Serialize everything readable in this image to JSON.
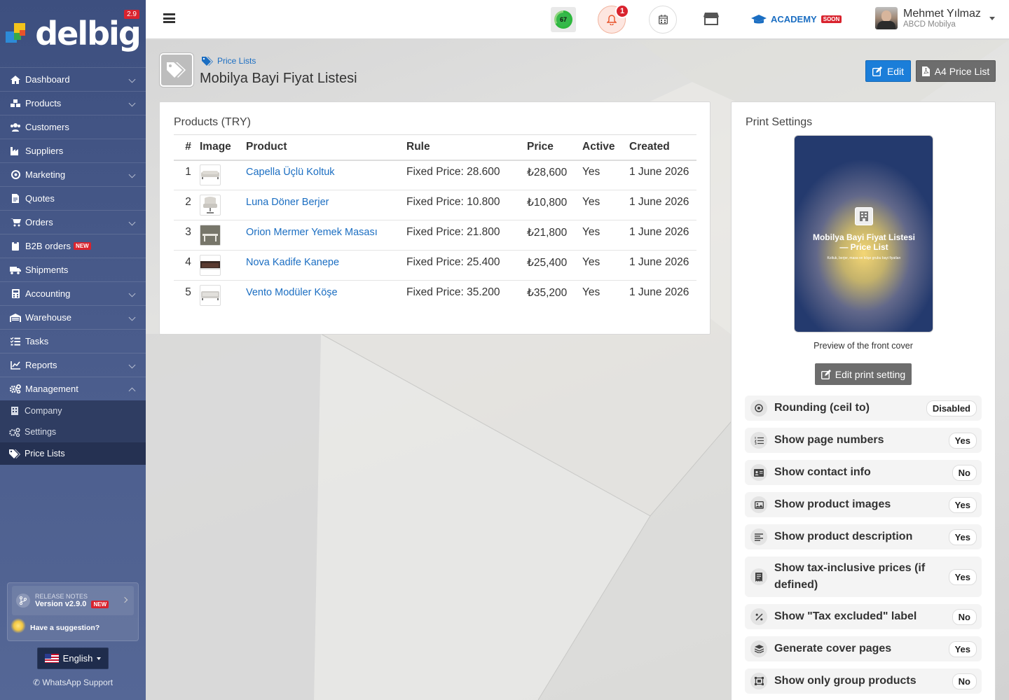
{
  "app": {
    "logo_text": "delbig",
    "version_badge": "2.9"
  },
  "sidebar": {
    "items": [
      {
        "label": "Dashboard",
        "icon": "home-icon",
        "chevron": true
      },
      {
        "label": "Products",
        "icon": "cubes-icon",
        "chevron": true
      },
      {
        "label": "Customers",
        "icon": "users-icon",
        "chevron": false
      },
      {
        "label": "Suppliers",
        "icon": "industry-icon",
        "chevron": false
      },
      {
        "label": "Marketing",
        "icon": "bullseye-icon",
        "chevron": true
      },
      {
        "label": "Quotes",
        "icon": "document-icon",
        "chevron": false
      },
      {
        "label": "Orders",
        "icon": "cart-icon",
        "chevron": true
      },
      {
        "label": "B2B orders",
        "icon": "clipboard-icon",
        "chevron": false,
        "badge": "NEW"
      },
      {
        "label": "Shipments",
        "icon": "truck-icon",
        "chevron": false
      },
      {
        "label": "Accounting",
        "icon": "calculator-icon",
        "chevron": true
      },
      {
        "label": "Warehouse",
        "icon": "warehouse-icon",
        "chevron": true
      },
      {
        "label": "Tasks",
        "icon": "tasks-icon",
        "chevron": false
      },
      {
        "label": "Reports",
        "icon": "chart-line-icon",
        "chevron": true
      },
      {
        "label": "Management",
        "icon": "cogs-icon",
        "chevron": true,
        "expanded": true
      }
    ],
    "subitems": [
      {
        "label": "Company",
        "icon": "building-icon"
      },
      {
        "label": "Settings",
        "icon": "gears-icon"
      },
      {
        "label": "Price Lists",
        "icon": "tags-icon",
        "active": true
      }
    ],
    "release": {
      "title": "RELEASE NOTES",
      "version": "Version v2.9.0",
      "badge": "NEW",
      "suggest": "Have a suggestion?"
    },
    "language": "English",
    "whatsapp": "WhatsApp Support"
  },
  "topbar": {
    "score": "67",
    "notification_count": "1",
    "academy": "ACADEMY",
    "academy_badge": "SOON",
    "user_name": "Mehmet Yılmaz",
    "company": "ABCD Mobilya"
  },
  "page": {
    "breadcrumb": "Price Lists",
    "title": "Mobilya Bayi Fiyat Listesi",
    "edit_label": "Edit",
    "a4_label": "A4 Price List"
  },
  "products": {
    "title": "Products (TRY)",
    "columns": [
      "#",
      "Image",
      "Product",
      "Rule",
      "Price",
      "Active",
      "Created"
    ],
    "rows": [
      {
        "n": "1",
        "name": "Capella Üçlü Koltuk",
        "rule": "Fixed Price: 28.600",
        "price": "₺28,600",
        "active": "Yes",
        "created": "1 June 2026"
      },
      {
        "n": "2",
        "name": "Luna Döner Berjer",
        "rule": "Fixed Price: 10.800",
        "price": "₺10,800",
        "active": "Yes",
        "created": "1 June 2026"
      },
      {
        "n": "3",
        "name": "Orion Mermer Yemek Masası",
        "rule": "Fixed Price: 21.800",
        "price": "₺21,800",
        "active": "Yes",
        "created": "1 June 2026"
      },
      {
        "n": "4",
        "name": "Nova Kadife Kanepe",
        "rule": "Fixed Price: 25.400",
        "price": "₺25,400",
        "active": "Yes",
        "created": "1 June 2026"
      },
      {
        "n": "5",
        "name": "Vento Modüler Köşe",
        "rule": "Fixed Price: 35.200",
        "price": "₺35,200",
        "active": "Yes",
        "created": "1 June 2026"
      }
    ]
  },
  "print": {
    "title": "Print Settings",
    "cover_title": "Mobilya Bayi Fiyat Listesi — Price List",
    "cover_subtitle": "Koltuk, berjer, masa ve köşe grubu bayi fiyatları",
    "cover_caption": "Preview of the front cover",
    "edit_button": "Edit print setting",
    "settings": [
      {
        "label": "Rounding (ceil to)",
        "value": "Disabled",
        "icon": "circle-dot-icon"
      },
      {
        "label": "Show page numbers",
        "value": "Yes",
        "icon": "list-ol-icon"
      },
      {
        "label": "Show contact info",
        "value": "No",
        "icon": "id-card-icon"
      },
      {
        "label": "Show product images",
        "value": "Yes",
        "icon": "image-icon"
      },
      {
        "label": "Show product description",
        "value": "Yes",
        "icon": "align-left-icon"
      },
      {
        "label": "Show tax-inclusive prices (if defined)",
        "value": "Yes",
        "icon": "receipt-icon"
      },
      {
        "label": "Show \"Tax excluded\" label",
        "value": "No",
        "icon": "percent-icon"
      },
      {
        "label": "Generate cover pages",
        "value": "Yes",
        "icon": "layers-icon"
      },
      {
        "label": "Show only group products",
        "value": "No",
        "icon": "object-group-icon"
      }
    ]
  }
}
